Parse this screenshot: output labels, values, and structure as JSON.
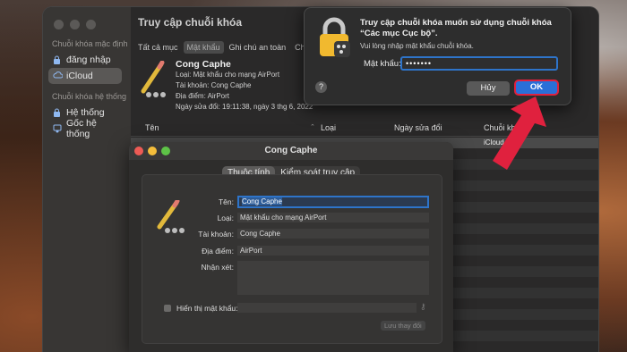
{
  "main_window": {
    "title": "Truy cập chuỗi khóa",
    "sidebar": {
      "default_section": "Chuỗi khóa mặc định",
      "default_items": [
        {
          "label": "đăng nhập",
          "icon": "lock-icon"
        },
        {
          "label": "iCloud",
          "icon": "cloud-icon",
          "selected": true
        }
      ],
      "system_section": "Chuỗi khóa hệ thống",
      "system_items": [
        {
          "label": "Hệ thống",
          "icon": "lock-icon"
        },
        {
          "label": "Gốc hệ thống",
          "icon": "certificate-icon"
        }
      ]
    },
    "tabs": [
      "Tất cả mục",
      "Mật khẩu",
      "Ghi chú an toàn",
      "Chứng"
    ],
    "selected_tab": "Mật khẩu",
    "item": {
      "name": "Cong Caphe",
      "type_line": "Loại: Mật khẩu cho mạng AirPort",
      "account_line": "Tài khoản: Cong Caphe",
      "location_line": "Địa điểm: AirPort",
      "modified_line": "Ngày sửa đổi: 19:11:38, ngày 3 thg 6, 2022"
    },
    "columns": [
      "Tên",
      "Loại",
      "Ngày sửa đổi",
      "Chuỗi khóa"
    ],
    "first_row_keychain": "iCloud"
  },
  "detail_window": {
    "title": "Cong Caphe",
    "segments": [
      "Thuộc tính",
      "Kiểm soát truy cập"
    ],
    "selected_segment": "Thuộc tính",
    "fields": {
      "name_label": "Tên:",
      "name_value": "Cong Caphe",
      "type_label": "Loại:",
      "type_value": "Mật khẩu cho mạng AirPort",
      "account_label": "Tài khoản:",
      "account_value": "Cong Caphe",
      "location_label": "Địa điểm:",
      "location_value": "AirPort",
      "comment_label": "Nhận xét:",
      "show_password_label": "Hiển thị mật khẩu:"
    },
    "save_label": "Lưu thay đổi"
  },
  "auth_sheet": {
    "title": "Truy cập chuỗi khóa muốn sử dụng chuỗi khóa “Các mục Cục bộ”.",
    "subtitle": "Vui lòng nhập mật khẩu chuỗi khóa.",
    "password_label": "Mật khẩu:",
    "password_value": "•••••••",
    "help": "?",
    "cancel_label": "Hủy",
    "ok_label": "OK"
  },
  "colors": {
    "accent": "#2a6fd8",
    "highlight": "#e0213e"
  }
}
